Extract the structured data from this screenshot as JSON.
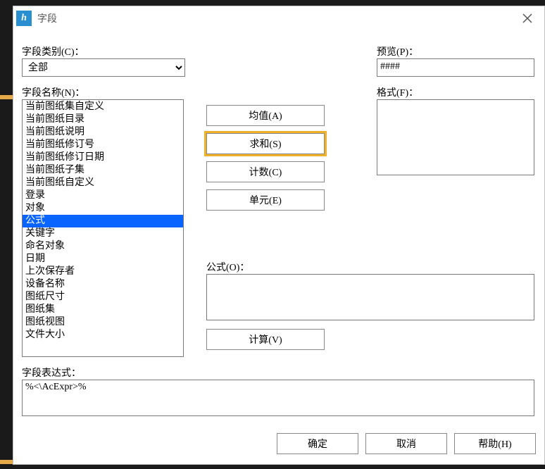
{
  "app_icon_text": "h",
  "title": "字段",
  "category_label": "字段类别(C)：",
  "category_value": "全部",
  "names_label": "字段名称(N)：",
  "names_list": [
    "当前图纸集自定义",
    "当前图纸目录",
    "当前图纸说明",
    "当前图纸修订号",
    "当前图纸修订日期",
    "当前图纸子集",
    "当前图纸自定义",
    "登录",
    "对象",
    "公式",
    "关键字",
    "命名对象",
    "日期",
    "上次保存者",
    "设备名称",
    "图纸尺寸",
    "图纸集",
    "图纸视图",
    "文件大小"
  ],
  "names_selected_index": 9,
  "mid_buttons": {
    "avg": "均值(A)",
    "sum": "求和(S)",
    "count": "计数(C)",
    "cell": "单元(E)"
  },
  "preview_label": "预览(P)：",
  "preview_value": "####",
  "format_label": "格式(F)：",
  "format_value": "",
  "formula_label": "公式(O)：",
  "formula_value": "",
  "calc_button": "计算(V)",
  "expr_label": "字段表达式：",
  "expr_value": "%<\\AcExpr>%",
  "footer": {
    "ok": "确定",
    "cancel": "取消",
    "help": "帮助(H)"
  }
}
